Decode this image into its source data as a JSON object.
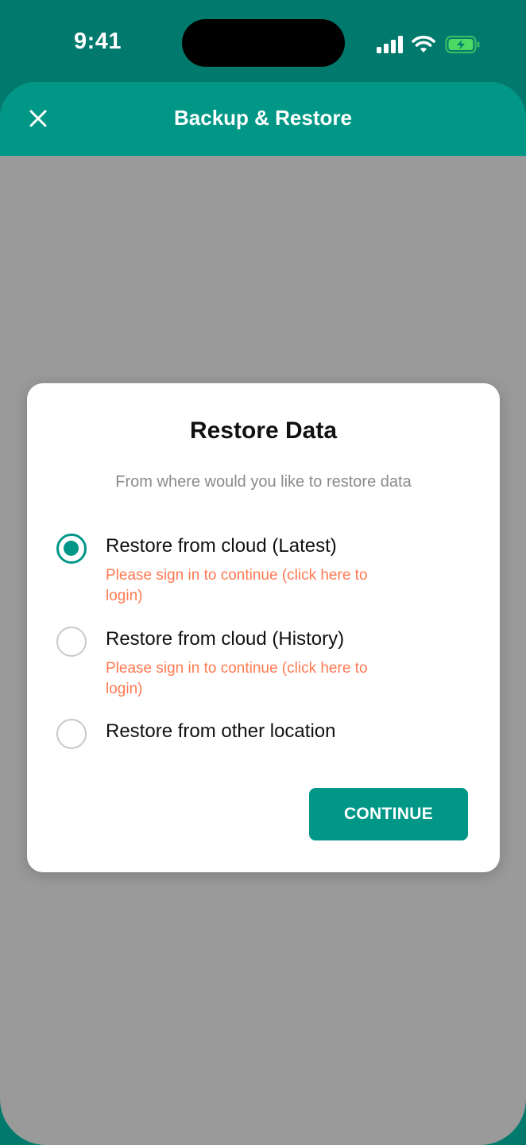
{
  "status_bar": {
    "time": "9:41",
    "icons": [
      "cellular-signal-icon",
      "wifi-icon",
      "battery-charging-icon"
    ]
  },
  "header": {
    "title": "Backup & Restore",
    "close_icon": "close-icon"
  },
  "dialog": {
    "title": "Restore Data",
    "subtitle": "From where would you like to restore data",
    "options": [
      {
        "label": "Restore from cloud (Latest)",
        "hint": "Please sign in to continue (click here to login)",
        "selected": true
      },
      {
        "label": "Restore from cloud (History)",
        "hint": "Please sign in to continue (click here to login)",
        "selected": false
      },
      {
        "label": "Restore from other location",
        "selected": false
      }
    ],
    "continue_label": "CONTINUE"
  },
  "colors": {
    "status_bar_bg": "#017a6d",
    "accent": "#009787",
    "hint_text": "#ff7a52",
    "overlay": "#9a9a9a",
    "battery": "#4cd964"
  }
}
